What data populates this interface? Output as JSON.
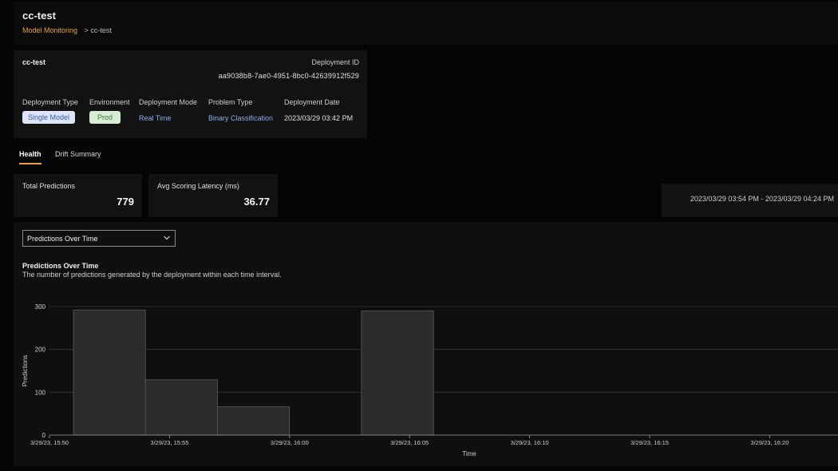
{
  "header": {
    "title": "cc-test",
    "breadcrumb_link": "Model Monitoring",
    "breadcrumb_separator": ">",
    "breadcrumb_current": "cc-test"
  },
  "deployment": {
    "name": "cc-test",
    "id_label": "Deployment ID",
    "id_value": "aa9038b8-7ae0-4951-8bc0-42639912f529",
    "fields": {
      "type_label": "Deployment Type",
      "type_value": "Single Model",
      "env_label": "Environment",
      "env_value": "Prod",
      "mode_label": "Deployment Mode",
      "mode_value": "Real Time",
      "problem_label": "Problem Type",
      "problem_value": "Binary Classification",
      "date_label": "Deployment Date",
      "date_value": "2023/03/29 03:42 PM"
    }
  },
  "tabs": {
    "health": "Health",
    "drift": "Drift Summary",
    "active": "Health"
  },
  "metrics": {
    "total_label": "Total Predictions",
    "total_value": "779",
    "latency_label": "Avg Scoring Latency (ms)",
    "latency_value": "36.77"
  },
  "time_range": "2023/03/29 03:54 PM - 2023/03/29 04:24 PM",
  "chart_select": {
    "selected": "Predictions Over Time"
  },
  "chart_header": {
    "title": "Predictions Over Time",
    "subtitle": "The number of predictions generated by the deployment within each time interval."
  },
  "colors": {
    "accent": "#e8a33a",
    "bar_fill": "#2b2b2b",
    "bar_stroke": "#5a5a5a"
  },
  "chart_data": {
    "type": "bar",
    "title": "Predictions Over Time",
    "subtitle": "The number of predictions generated by the deployment within each time interval.",
    "xlabel": "Time",
    "ylabel": "Predictions",
    "ylim": [
      0,
      300
    ],
    "yticks": [
      0,
      100,
      200,
      300
    ],
    "x_ticks": [
      "3/29/23, 15:50",
      "3/29/23, 15:55",
      "3/29/23, 16:00",
      "3/29/23, 16:05",
      "3/29/23, 16:10",
      "3/29/23, 16:15",
      "3/29/23, 16:20"
    ],
    "bars": [
      {
        "start": "3/29/23, 15:50",
        "end": "3/29/23, 15:53",
        "value": 292
      },
      {
        "start": "3/29/23, 15:53",
        "end": "3/29/23, 15:56",
        "value": 129
      },
      {
        "start": "3/29/23, 15:56",
        "end": "3/29/23, 15:59",
        "value": 66
      },
      {
        "start": "3/29/23, 16:02",
        "end": "3/29/23, 16:05",
        "value": 290
      }
    ],
    "bar_minutes_offset": [
      0,
      3,
      6,
      12
    ],
    "bar_width_minutes": 3,
    "grid": true
  }
}
